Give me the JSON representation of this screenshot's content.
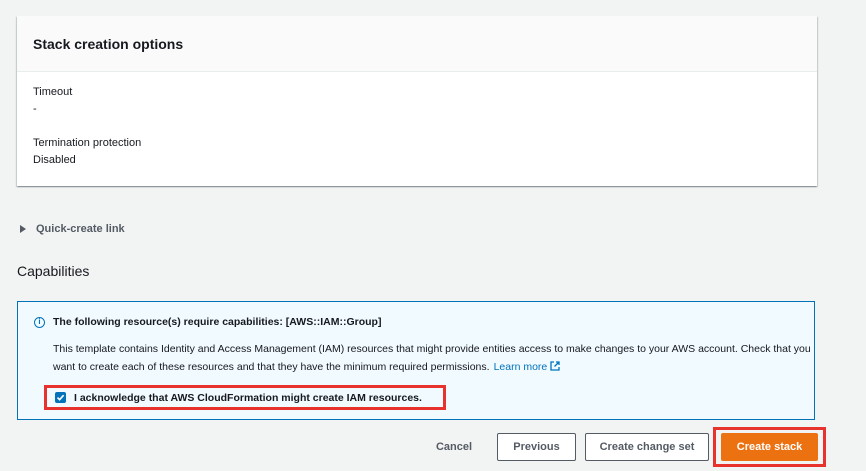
{
  "stack_options": {
    "title": "Stack creation options",
    "timeout_label": "Timeout",
    "timeout_value": "-",
    "termination_label": "Termination protection",
    "termination_value": "Disabled"
  },
  "quick_create": {
    "label": "Quick-create link",
    "icon": "caret-right-icon"
  },
  "capabilities": {
    "title": "Capabilities",
    "info_icon": "info-icon",
    "heading": "The following resource(s) require capabilities: [AWS::IAM::Group]",
    "body": "This template contains Identity and Access Management (IAM) resources that might provide entities access to make changes to your AWS account. Check that you want to create each of these resources and that they have the minimum required permissions.",
    "learn_more": "Learn more",
    "ack_label": "I acknowledge that AWS CloudFormation might create IAM resources.",
    "ack_checked": true
  },
  "actions": {
    "cancel": "Cancel",
    "previous": "Previous",
    "create_change_set": "Create change set",
    "create_stack": "Create stack"
  },
  "colors": {
    "primary": "#ec7211",
    "link": "#0073bb",
    "highlight": "#e8322e"
  }
}
